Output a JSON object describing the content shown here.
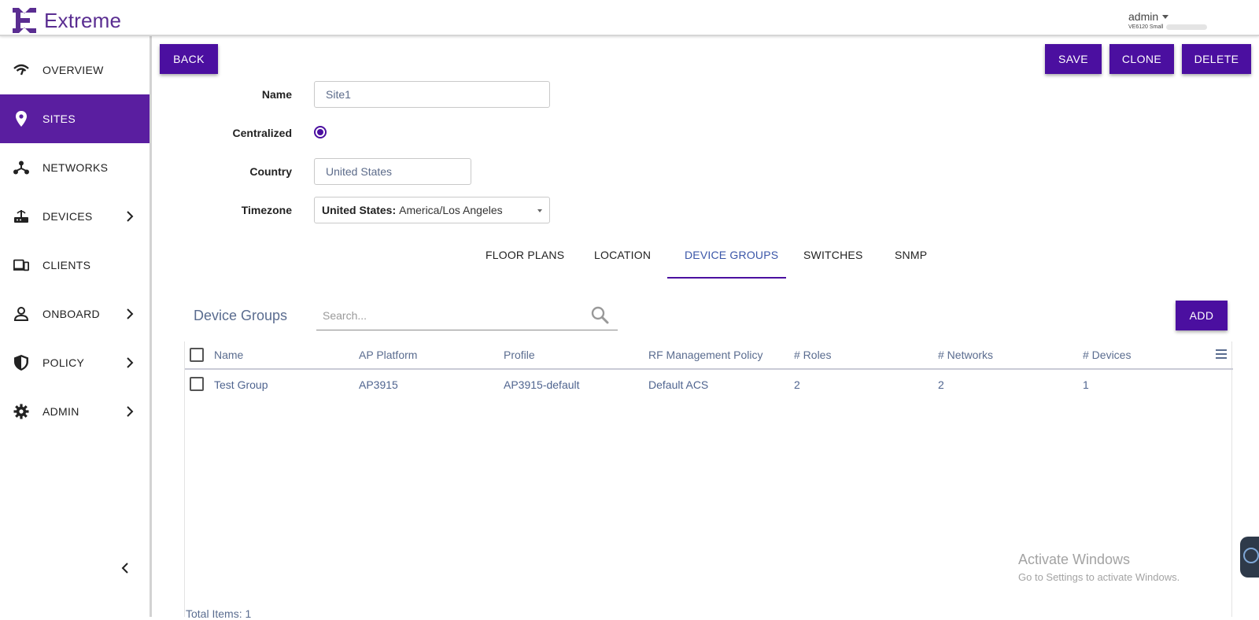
{
  "brand": {
    "name": "Extreme",
    "color": "#5a2d91"
  },
  "user": {
    "name": "admin",
    "subtitle": "VE6120 Small"
  },
  "sidebar": {
    "items": [
      {
        "label": "OVERVIEW",
        "icon": "wifi-icon",
        "has_submenu": false,
        "active": false
      },
      {
        "label": "SITES",
        "icon": "location-pin-icon",
        "has_submenu": false,
        "active": true
      },
      {
        "label": "NETWORKS",
        "icon": "network-icon",
        "has_submenu": false,
        "active": false
      },
      {
        "label": "DEVICES",
        "icon": "router-icon",
        "has_submenu": true,
        "active": false
      },
      {
        "label": "CLIENTS",
        "icon": "clients-icon",
        "has_submenu": false,
        "active": false
      },
      {
        "label": "ONBOARD",
        "icon": "person-icon",
        "has_submenu": true,
        "active": false
      },
      {
        "label": "POLICY",
        "icon": "shield-icon",
        "has_submenu": true,
        "active": false
      },
      {
        "label": "ADMIN",
        "icon": "gear-icon",
        "has_submenu": true,
        "active": false
      }
    ],
    "active_color": "#5a1ea0"
  },
  "toolbar": {
    "back": "BACK",
    "save": "SAVE",
    "clone": "CLONE",
    "delete": "DELETE",
    "button_color": "#4b0fa0"
  },
  "form": {
    "name": {
      "label": "Name",
      "value": "Site1"
    },
    "centralized": {
      "label": "Centralized",
      "checked": true
    },
    "country": {
      "label": "Country",
      "value": "United States"
    },
    "timezone": {
      "label": "Timezone",
      "value_prefix": "United States:",
      "value": "America/Los Angeles"
    }
  },
  "tabs": [
    {
      "label": "FLOOR PLANS",
      "active": false
    },
    {
      "label": "LOCATION",
      "active": false
    },
    {
      "label": "DEVICE GROUPS",
      "active": true
    },
    {
      "label": "SWITCHES",
      "active": false
    },
    {
      "label": "SNMP",
      "active": false
    }
  ],
  "device_groups": {
    "title": "Device Groups",
    "search_placeholder": "Search...",
    "add": "ADD",
    "columns": [
      "Name",
      "AP Platform",
      "Profile",
      "RF Management Policy",
      "# Roles",
      "# Networks",
      "# Devices"
    ],
    "rows": [
      [
        "Test Group",
        "AP3915",
        "AP3915-default",
        "Default ACS",
        "2",
        "2",
        "1"
      ]
    ],
    "total": "Total Items: 1"
  },
  "watermark": {
    "title": "Activate Windows",
    "subtitle": "Go to Settings to activate Windows."
  }
}
